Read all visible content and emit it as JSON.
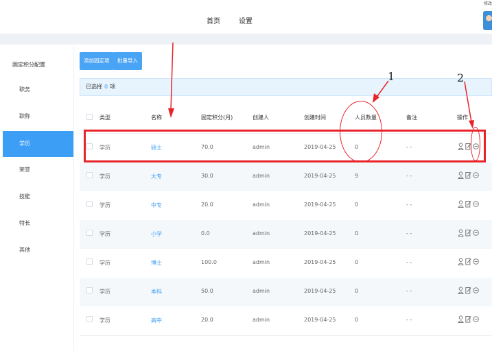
{
  "window_hint": "修改",
  "nav": {
    "home": "首页",
    "settings": "设置"
  },
  "sidebar": {
    "title": "固定积分配置",
    "items": [
      {
        "label": "职务",
        "active": false
      },
      {
        "label": "职称",
        "active": false
      },
      {
        "label": "学历",
        "active": true
      },
      {
        "label": "荣誉",
        "active": false
      },
      {
        "label": "技能",
        "active": false
      },
      {
        "label": "特长",
        "active": false
      },
      {
        "label": "其他",
        "active": false
      }
    ]
  },
  "toolbar": {
    "add_label": "添加固定项",
    "import_label": "批量导入"
  },
  "selection": {
    "prefix": "已选择",
    "count": "0",
    "suffix": "项"
  },
  "table": {
    "headers": [
      "类型",
      "名称",
      "固定积分(月)",
      "创建人",
      "创建时间",
      "人员数量",
      "备注",
      "操作"
    ],
    "rows": [
      {
        "type": "学历",
        "name": "硕士",
        "points": "70.0",
        "creator": "admin",
        "created": "2019-04-25",
        "count": "0",
        "note": "- -"
      },
      {
        "type": "学历",
        "name": "大专",
        "points": "30.0",
        "creator": "admin",
        "created": "2019-04-25",
        "count": "9",
        "note": "- -"
      },
      {
        "type": "学历",
        "name": "中专",
        "points": "20.0",
        "creator": "admin",
        "created": "2019-04-25",
        "count": "0",
        "note": "- -"
      },
      {
        "type": "学历",
        "name": "小学",
        "points": "0.0",
        "creator": "admin",
        "created": "2019-04-25",
        "count": "0",
        "note": "- -"
      },
      {
        "type": "学历",
        "name": "博士",
        "points": "100.0",
        "creator": "admin",
        "created": "2019-04-25",
        "count": "0",
        "note": "- -"
      },
      {
        "type": "学历",
        "name": "本科",
        "points": "50.0",
        "creator": "admin",
        "created": "2019-04-25",
        "count": "0",
        "note": "- -"
      },
      {
        "type": "学历",
        "name": "高中",
        "points": "20.0",
        "creator": "admin",
        "created": "2019-04-25",
        "count": "0",
        "note": "- -"
      }
    ],
    "row_actions": [
      "user-icon",
      "edit-icon",
      "minus-circle-icon"
    ]
  },
  "annotations": {
    "label_1": "1",
    "label_2": "2",
    "color": "#e8232a"
  },
  "colors": {
    "accent": "#3d9ef5",
    "band": "#eef1f6"
  }
}
